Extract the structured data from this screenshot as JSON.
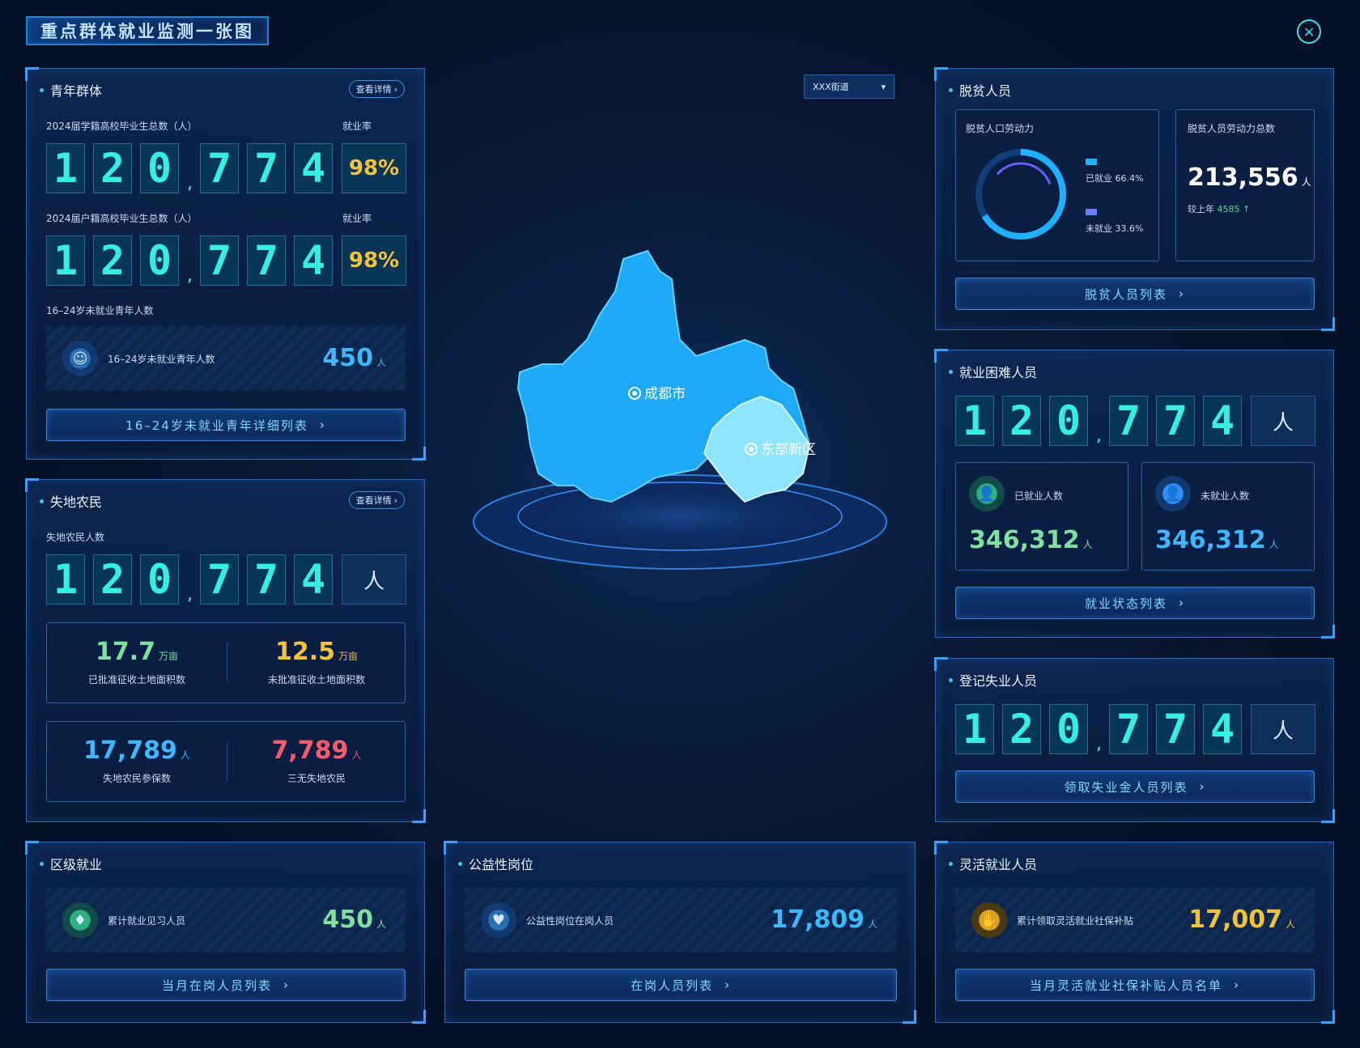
{
  "title": "重点群体就业监测一张图",
  "close_icon": "×",
  "district_select": "XXX街道",
  "map": {
    "city": "成都市",
    "new_area": "东部新区"
  },
  "youth": {
    "title": "青年群体",
    "detail": "查看详情",
    "label1": "2024届学籍高校毕业生总数（人）",
    "rate_label1": "就业率",
    "digits1": [
      "1",
      "2",
      "0",
      "7",
      "7",
      "4"
    ],
    "rate1": "98%",
    "label2": "2024届户籍高校毕业生总数（人）",
    "rate_label2": "就业率",
    "digits2": [
      "1",
      "2",
      "0",
      "7",
      "7",
      "4"
    ],
    "rate2": "98%",
    "label3": "16–24岁未就业青年人数",
    "inner_label": "16–24岁未就业青年人数",
    "inner_value": "450",
    "inner_unit": "人",
    "button": "16–24岁未就业青年详细列表"
  },
  "farmers": {
    "title": "失地农民",
    "detail": "查看详情",
    "label": "失地农民人数",
    "digits": [
      "1",
      "2",
      "0",
      "7",
      "7",
      "4"
    ],
    "unit": "人",
    "approved_value": "17.7",
    "approved_unit": "万亩",
    "approved_label": "已批准征收土地面积数",
    "unapproved_value": "12.5",
    "unapproved_unit": "万亩",
    "unapproved_label": "未批准征收土地面积数",
    "insured_value": "17,789",
    "insured_unit": "人",
    "insured_label": "失地农民参保数",
    "sanwu_value": "7,789",
    "sanwu_unit": "人",
    "sanwu_label": "三无失地农民"
  },
  "poverty": {
    "title": "脱贫人员",
    "labor_title": "脱贫人口劳动力",
    "employed_label": "已就业",
    "employed_pct": "66.4%",
    "employed_fraction": 0.664,
    "unemployed_label": "未就业",
    "unemployed_pct": "33.6%",
    "total_title": "脱贫人员劳动力总数",
    "total_value": "213,556",
    "total_unit": "人",
    "yoy_label": "较上年",
    "yoy_value": "4585 ↑",
    "button": "脱贫人员列表"
  },
  "difficult": {
    "title": "就业困难人员",
    "digits": [
      "1",
      "2",
      "0",
      "7",
      "7",
      "4"
    ],
    "unit": "人",
    "employed_label": "已就业人数",
    "employed_value": "346,312",
    "employed_unit": "人",
    "unemployed_label": "未就业人数",
    "unemployed_value": "346,312",
    "unemployed_unit": "人",
    "button": "就业状态列表"
  },
  "registered": {
    "title": "登记失业人员",
    "digits": [
      "1",
      "2",
      "0",
      "7",
      "7",
      "4"
    ],
    "unit": "人",
    "button": "领取失业金人员列表"
  },
  "district": {
    "title": "区级就业",
    "label": "累计就业见习人员",
    "value": "450",
    "unit": "人",
    "button": "当月在岗人员列表"
  },
  "public": {
    "title": "公益性岗位",
    "label": "公益性岗位在岗人员",
    "value": "17,809",
    "unit": "人",
    "button": "在岗人员列表"
  },
  "flexible": {
    "title": "灵活就业人员",
    "label": "累计领取灵活就业社保补贴",
    "value": "17,007",
    "unit": "人",
    "button": "当月灵活就业社保补贴人员名单"
  },
  "chevron": "›"
}
